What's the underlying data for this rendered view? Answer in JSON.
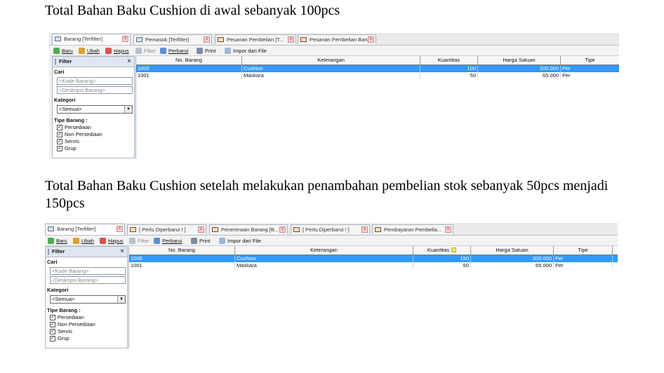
{
  "captions": {
    "before": "Total Bahan Baku Cushion di awal sebanyak 100pcs",
    "after": "Total Bahan Baku Cushion setelah melakukan penambahan pembelian stok sebanyak 50pcs menjadi 150pcs"
  },
  "shot1": {
    "tabs": [
      "Barang [Terfilter]",
      "Pemasok [Terfilter]",
      "Pesanan Pembelian [T...",
      "Pesanan Pembelian Baru"
    ],
    "rows": [
      {
        "no": "1000",
        "ket": "Cushion",
        "qty": "100",
        "harga": "200.000",
        "tipe": "Per"
      },
      {
        "no": "1001",
        "ket": "Maskara",
        "qty": "50",
        "harga": "65.000",
        "tipe": "Per"
      }
    ]
  },
  "shot2": {
    "tabs": [
      "Barang [Terfilter]",
      "[ Perlu Diperbarui ! ]",
      "Penerimaan Barang [B...",
      "[ Perlu Diperbarui ! ]",
      "Pembayaran Pembelia..."
    ],
    "rows": [
      {
        "no": "1000",
        "ket": "Cushion",
        "qty": "150",
        "harga": "200.000",
        "tipe": "Per"
      },
      {
        "no": "1001",
        "ket": "Maskara",
        "qty": "50",
        "harga": "65.000",
        "tipe": "Per"
      }
    ]
  },
  "toolbar": {
    "baru": "Baru",
    "ubah": "Ubah",
    "hapus": "Hapus",
    "filter": "Filter",
    "perbarui": "Perbarui",
    "print": "Print",
    "impor": "Impor dari File"
  },
  "filter": {
    "title": "Filter",
    "close": "×",
    "cari": "Cari",
    "kode_placeholder": "<Kode Barang>",
    "deskripsi_placeholder": "<Deskripsi Barang>",
    "kategori": "Kategori",
    "kategori_value": "<Semua>",
    "tipe_barang": "Tipe Barang :",
    "tipe_options": [
      "Persediaan",
      "Non Persediaan",
      "Servis",
      "Grup"
    ]
  },
  "columns": {
    "no": "No. Barang",
    "ket": "Keterangan",
    "qty": "Kuantitas",
    "harga": "Harga Satuan",
    "tipe": "Tipe"
  },
  "icons": {
    "tab_close": "close-icon",
    "barang_tab": "table-icon",
    "cart_tab": "cart-icon",
    "baru": "new-icon",
    "ubah": "edit-icon",
    "hapus": "delete-icon",
    "filter": "filter-icon",
    "perbarui": "refresh-icon",
    "print": "printer-icon",
    "impor": "import-icon"
  },
  "colors": {
    "selection": "#3399ff",
    "panel_header": "#dfe6f0"
  }
}
